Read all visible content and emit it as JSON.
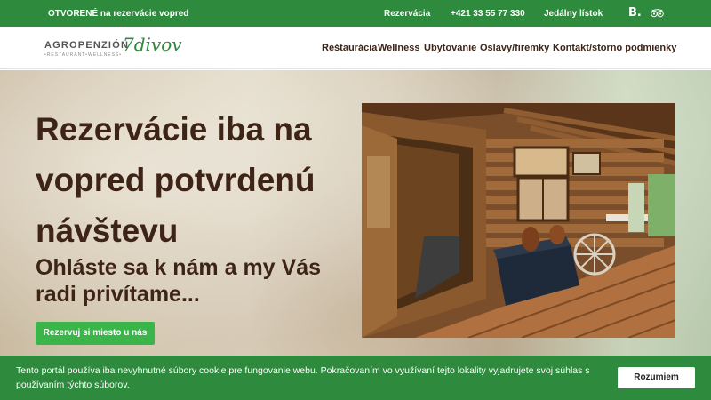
{
  "topbar": {
    "status": "OTVORENÉ na rezervácie vopred",
    "reservation_link": "Rezervácia",
    "phone": "+421 33 55 77 330",
    "menu_link": "Jedálny lístok",
    "booking_icon_text": "B.",
    "tripadvisor_icon": "tripadvisor-owl-icon",
    "bg_color": "#2e8a3c"
  },
  "logo": {
    "main": "AGROPENZIÓN",
    "sub": "•RESTAURANT•WELLNESS•",
    "script": "7divov"
  },
  "nav": {
    "items": [
      {
        "label": "Reštaurácia"
      },
      {
        "label": "Wellness"
      },
      {
        "label": "Ubytovanie"
      },
      {
        "label": "Oslavy/firemky"
      },
      {
        "label": "Kontakt/storno podmienky"
      }
    ]
  },
  "hero": {
    "title": "Rezervácie iba na vopred potvrdenú návštevu",
    "subtitle": "Ohláste sa k nám a my Vás radi privítame...",
    "cta_label": "Rezervuj si miesto u nás",
    "cta_color": "#3bb54a",
    "text_color": "#3d2416"
  },
  "cookie": {
    "text": "Tento portál používa iba nevyhnutné súbory cookie pre fungovanie webu. Pokračovaním vo využívaní tejto lokality vyjadrujete svoj súhlas s používaním týchto súborov.",
    "accept_label": "Rozumiem"
  }
}
